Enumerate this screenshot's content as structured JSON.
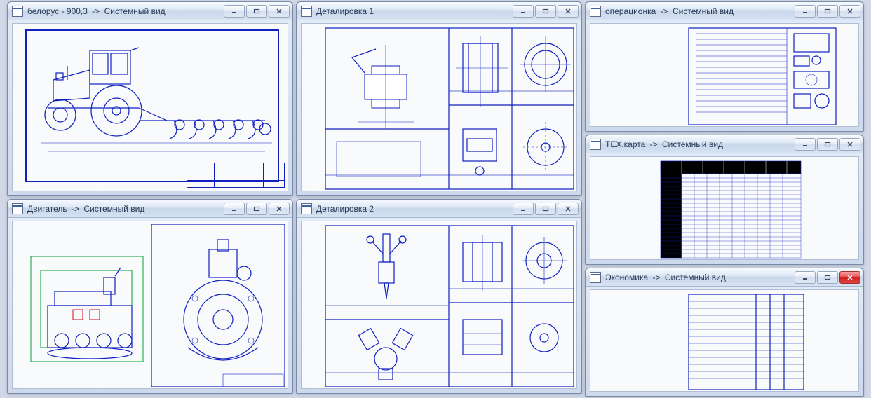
{
  "windows": {
    "w1": {
      "filename": "белорус - 900,3",
      "suffix": "Системный вид"
    },
    "w2": {
      "filename": "Деталировка 1",
      "suffix": ""
    },
    "w3": {
      "filename": "операционка",
      "suffix": "Системный вид"
    },
    "w4": {
      "filename": "Двигатель",
      "suffix": "Системный вид"
    },
    "w5": {
      "filename": "Деталировка 2",
      "suffix": ""
    },
    "w6": {
      "filename": "ТЕХ.карта",
      "suffix": "Системный вид"
    },
    "w7": {
      "filename": "Экономика",
      "suffix": "Системный вид"
    }
  },
  "arrow": "->",
  "icons": {
    "min": "—",
    "max": "☐",
    "close": "✕"
  }
}
